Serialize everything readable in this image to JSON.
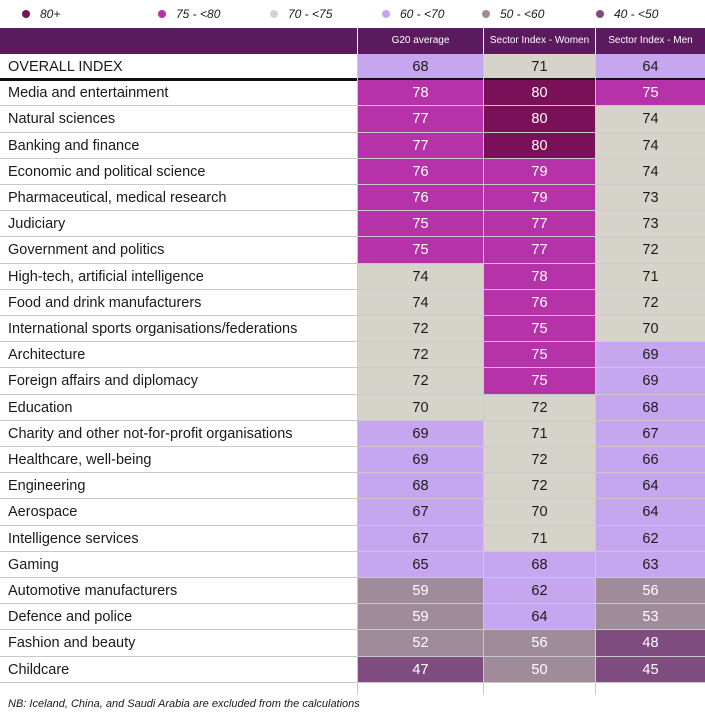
{
  "legend": [
    {
      "label": "80+",
      "color": "#7a1158"
    },
    {
      "label": "75 - <80",
      "color": "#b632a8"
    },
    {
      "label": "70 - <75",
      "color": "#d6d4ca"
    },
    {
      "label": "60 - <70",
      "color": "#c6a6ee"
    },
    {
      "label": "50 - <60",
      "color": "#a08b9b"
    },
    {
      "label": "40 - <50",
      "color": "#7f4c80"
    }
  ],
  "header": {
    "col1": "G20 average",
    "col2": "Sector Index - Women",
    "col3": "Sector Index - Men"
  },
  "note": "NB: Iceland, China, and Saudi Arabia are excluded from the calculations",
  "chart_data": {
    "type": "table",
    "columns": [
      "G20 average",
      "Sector Index - Women",
      "Sector Index - Men"
    ],
    "rows": [
      {
        "label": "OVERALL INDEX",
        "values": [
          68,
          71,
          64
        ]
      },
      {
        "label": "Media and entertainment",
        "values": [
          78,
          80,
          75
        ]
      },
      {
        "label": "Natural sciences",
        "values": [
          77,
          80,
          74
        ]
      },
      {
        "label": "Banking and finance",
        "values": [
          77,
          80,
          74
        ]
      },
      {
        "label": "Economic and political science",
        "values": [
          76,
          79,
          74
        ]
      },
      {
        "label": "Pharmaceutical, medical research",
        "values": [
          76,
          79,
          73
        ]
      },
      {
        "label": "Judiciary",
        "values": [
          75,
          77,
          73
        ]
      },
      {
        "label": "Government and politics",
        "values": [
          75,
          77,
          72
        ]
      },
      {
        "label": "High-tech, artificial intelligence",
        "values": [
          74,
          78,
          71
        ]
      },
      {
        "label": "Food and drink manufacturers",
        "values": [
          74,
          76,
          72
        ]
      },
      {
        "label": "International sports organisations/federations",
        "values": [
          72,
          75,
          70
        ]
      },
      {
        "label": "Architecture",
        "values": [
          72,
          75,
          69
        ]
      },
      {
        "label": "Foreign affairs and diplomacy",
        "values": [
          72,
          75,
          69
        ]
      },
      {
        "label": "Education",
        "values": [
          70,
          72,
          68
        ]
      },
      {
        "label": "Charity and other not-for-profit organisations",
        "values": [
          69,
          71,
          67
        ]
      },
      {
        "label": "Healthcare, well-being",
        "values": [
          69,
          72,
          66
        ]
      },
      {
        "label": "Engineering",
        "values": [
          68,
          72,
          64
        ]
      },
      {
        "label": "Aerospace",
        "values": [
          67,
          70,
          64
        ]
      },
      {
        "label": "Intelligence services",
        "values": [
          67,
          71,
          62
        ]
      },
      {
        "label": "Gaming",
        "values": [
          65,
          68,
          63
        ]
      },
      {
        "label": "Automotive manufacturers",
        "values": [
          59,
          62,
          56
        ]
      },
      {
        "label": "Defence and police",
        "values": [
          59,
          64,
          53
        ]
      },
      {
        "label": "Fashion and beauty",
        "values": [
          52,
          56,
          48
        ]
      },
      {
        "label": "Childcare",
        "values": [
          47,
          50,
          45
        ]
      }
    ]
  }
}
